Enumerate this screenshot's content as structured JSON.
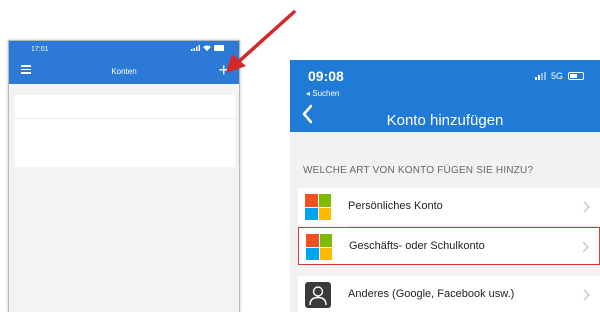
{
  "left_phone": {
    "time": "17:01",
    "title": "Konten",
    "add_symbol": "+",
    "accent_color": "#2c7ad6",
    "icons": [
      "menu-icon",
      "add-icon",
      "signal-icon",
      "wifi-icon",
      "battery-icon"
    ]
  },
  "annotation": {
    "arrow_color": "#d62828"
  },
  "right_phone": {
    "time": "09:08",
    "back_app": "◂ Suchen",
    "network": "5G",
    "title": "Konto hinzufügen",
    "accent_color": "#1f7bd6",
    "section_header": "WELCHE ART VON KONTO FÜGEN SIE HINZU?",
    "accounts": [
      {
        "label": "Persönliches Konto",
        "icon": "microsoft-logo-icon",
        "highlighted": false
      },
      {
        "label": "Geschäfts- oder Schulkonto",
        "icon": "microsoft-logo-icon",
        "highlighted": true
      },
      {
        "label": "Anderes (Google, Facebook usw.)",
        "icon": "person-icon",
        "highlighted": false
      }
    ],
    "highlight_color": "#d23b3b",
    "ms_logo_colors": [
      "#f25022",
      "#7fba00",
      "#00a4ef",
      "#ffb900"
    ]
  }
}
